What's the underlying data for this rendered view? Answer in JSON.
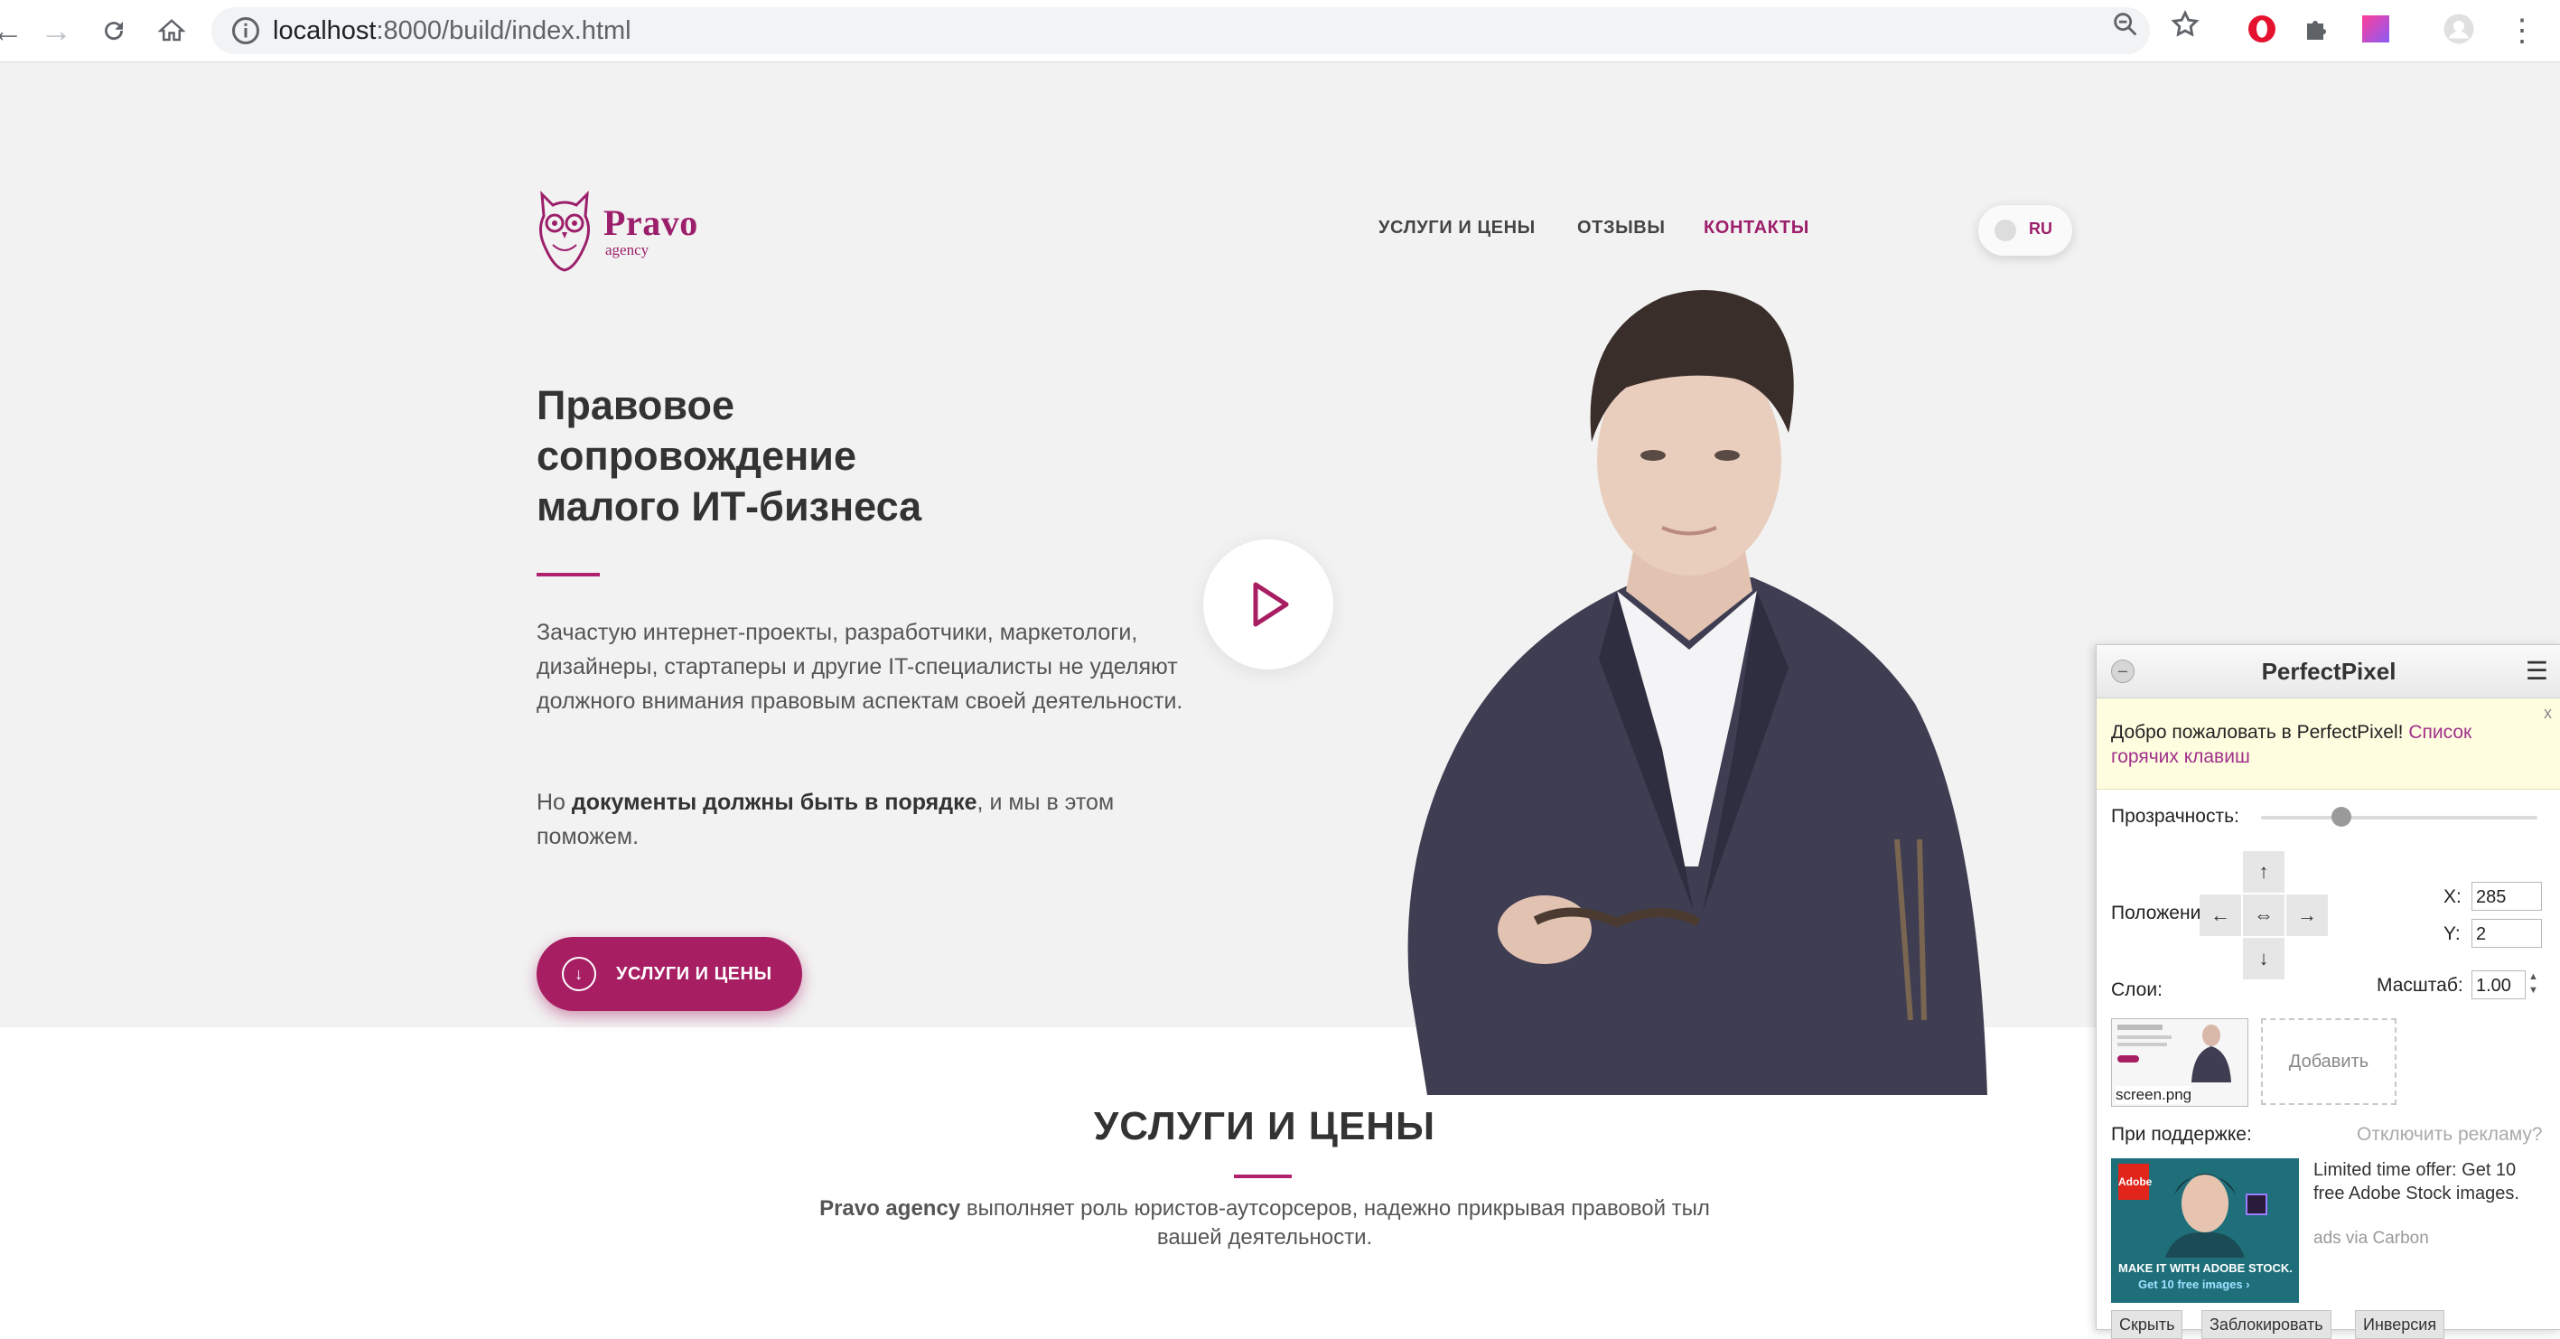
{
  "browser": {
    "url_host": "localhost",
    "url_rest": ":8000/build/index.html"
  },
  "site": {
    "logo": {
      "brand": "Pravo",
      "sub": "agency"
    },
    "menu": [
      {
        "label": "УСЛУГИ И ЦЕНЫ"
      },
      {
        "label": "ОТЗЫВЫ"
      },
      {
        "label": "КОНТАКТЫ"
      }
    ],
    "lang": "RU",
    "headline": [
      "Правовое",
      "сопровождение",
      "малого ИТ-бизнеса"
    ],
    "paragraph1": "Зачастую интернет-проекты, разработчики, маркетологи, дизайнеры, стартаперы и другие IT-специалисты не уделяют должного внимания правовым аспектам своей деятельности.",
    "paragraph2": {
      "pre": "Но ",
      "bold": "документы должны быть в порядке",
      "post": ", и мы в этом поможем."
    },
    "cta_label": "УСЛУГИ И ЦЕНЫ",
    "section": {
      "title": "УСЛУГИ И ЦЕНЫ",
      "sub_bold": "Pravo agency",
      "sub_rest": " выполняет роль юристов-аутсорсеров, надежно прикрывая правовой тыл вашей деятельности."
    }
  },
  "perfectpixel": {
    "title": "PerfectPixel",
    "welcome": "Добро пожаловать в PerfectPixel!",
    "welcome_link": "Список горячих клавиш",
    "close": "x",
    "opacity_label": "Прозрачность:",
    "opacity": 0.29,
    "position_label": "Положение:",
    "x_label": "X:",
    "x_value": "285",
    "y_label": "Y:",
    "y_value": "2",
    "scale_label": "Масштаб:",
    "scale_value": "1.00",
    "layers_label": "Слои:",
    "layer_name": "screen.png",
    "add_label": "Добавить",
    "support_label": "При поддержке:",
    "disable_ads": "Отключить рекламу?",
    "ad_text": "Limited time offer: Get 10 free Adobe Stock images.",
    "ad_via": "ads via Carbon",
    "ad_caption1": "MAKE IT WITH ADOBE STOCK.",
    "ad_caption2": "Get 10 free images ›",
    "ad_badge": "Adobe",
    "tabs": [
      "Скрыть",
      "Заблокировать",
      "Инверсия"
    ]
  }
}
